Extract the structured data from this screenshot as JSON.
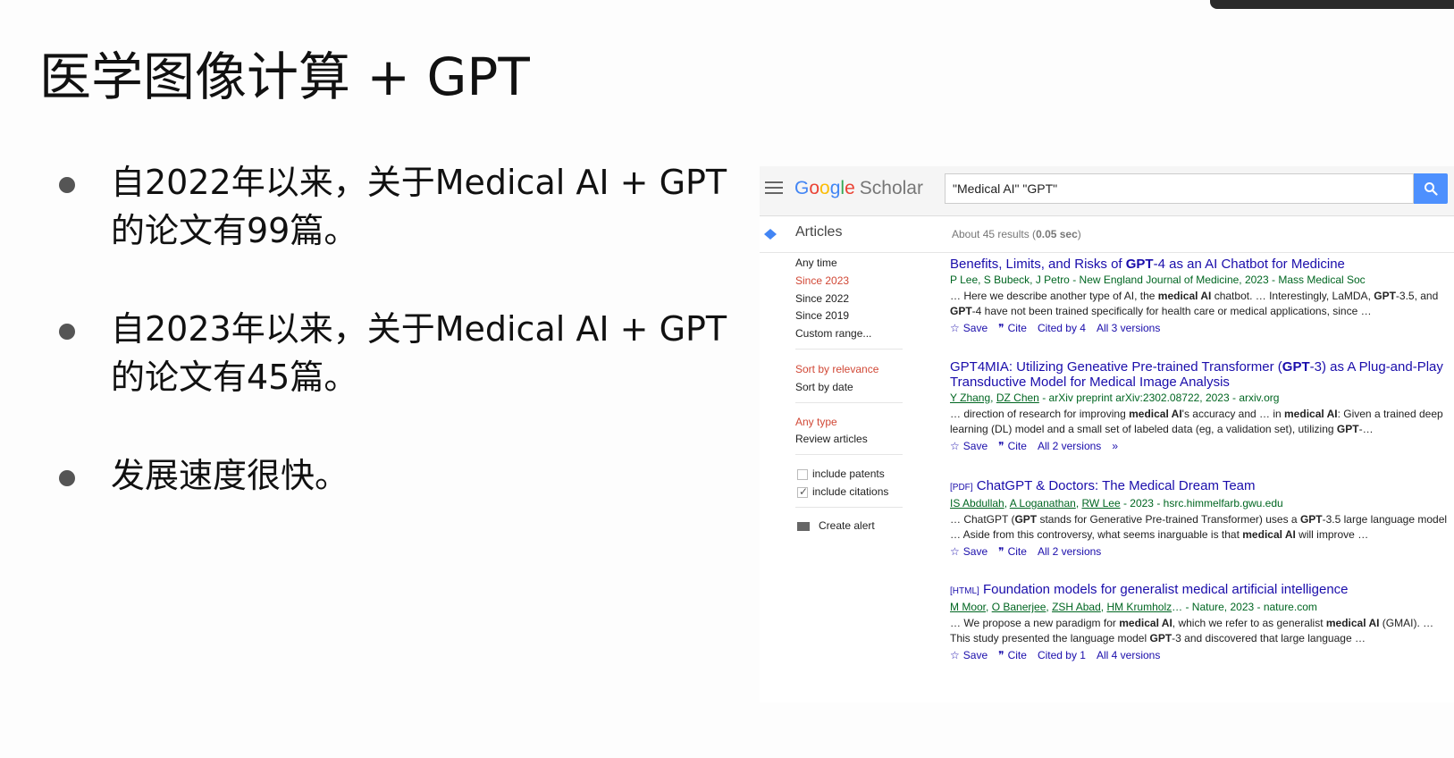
{
  "slide": {
    "title": "医学图像计算 + GPT",
    "bullets": [
      {
        "line1": "自2022年以来，关于Medical AI + GPT",
        "line2": "的论文有99篇。"
      },
      {
        "line1": "自2023年以来，关于Medical AI + GPT",
        "line2": "的论文有45篇。"
      },
      {
        "line1": "发展速度很快。",
        "line2": ""
      }
    ]
  },
  "scholar": {
    "logo": {
      "google": [
        "G",
        "o",
        "o",
        "g",
        "l",
        "e"
      ],
      "scholar": "Scholar"
    },
    "search_query": "\"Medical AI\" \"GPT\"",
    "articles_label": "Articles",
    "results_prefix": "About 45 results (",
    "results_time": "0.05 sec",
    "results_suffix": ")",
    "sidebar": {
      "time_filters": [
        "Any time",
        "Since 2023",
        "Since 2022",
        "Since 2019",
        "Custom range..."
      ],
      "sort": [
        "Sort by relevance",
        "Sort by date"
      ],
      "type": [
        "Any type",
        "Review articles"
      ],
      "include_patents": "include patents",
      "include_citations": "include citations",
      "create_alert": "Create alert"
    },
    "results": [
      {
        "tag": "",
        "title_html": "Benefits, Limits, and Risks of <b>GPT</b>-4 as an AI Chatbot for Medicine",
        "authors_html": "P Lee, S Bubeck, J Petro - New England Journal of Medicine, 2023 - Mass Medical Soc",
        "snippet_html": "… Here we describe another type of AI, the <b>medical AI</b> chatbot. … Interestingly, LaMDA, <b>GPT</b>-3.5, and <b>GPT</b>-4 have not been trained specifically for health care or medical applications, since …",
        "actions": [
          "Save",
          "Cite",
          "Cited by 4",
          "All 3 versions"
        ]
      },
      {
        "tag": "",
        "title_html": "GPT4MIA: Utilizing Geneative Pre-trained Transformer (<b>GPT</b>-3) as A Plug-and-Play Transductive Model for Medical Image Analysis",
        "authors_html": "<span class=\"ul\">Y Zhang</span>, <span class=\"ul\">DZ Chen</span> - arXiv preprint arXiv:2302.08722, 2023 - arxiv.org",
        "snippet_html": "… direction of research for improving <b>medical AI</b>'s accuracy and … in <b>medical AI</b>: Given a trained deep learning (DL) model and a small set of labeled data (eg, a validation set), utilizing <b>GPT</b>-…",
        "actions": [
          "Save",
          "Cite",
          "All 2 versions",
          "»"
        ]
      },
      {
        "tag": "[PDF]",
        "title_html": "ChatGPT &amp; Doctors: The Medical Dream Team",
        "authors_html": "<span class=\"ul\">IS Abdullah</span>, <span class=\"ul\">A Loganathan</span>, <span class=\"ul\">RW Lee</span> - 2023 - hsrc.himmelfarb.gwu.edu",
        "snippet_html": "… ChatGPT (<b>GPT</b> stands for Generative Pre-trained Transformer) uses a <b>GPT</b>-3.5 large language model … Aside from this controversy, what seems inarguable is that <b>medical AI</b> will improve …",
        "actions": [
          "Save",
          "Cite",
          "All 2 versions"
        ]
      },
      {
        "tag": "[HTML]",
        "title_html": "Foundation models for generalist medical artificial intelligence",
        "authors_html": "<span class=\"ul\">M Moor</span>, <span class=\"ul\">O Banerjee</span>, <span class=\"ul\">ZSH Abad</span>, <span class=\"ul\">HM Krumholz</span>… - Nature, 2023 - nature.com",
        "snippet_html": "… We propose a new paradigm for <b>medical AI</b>, which we refer to as generalist <b>medical AI</b> (GMAI). … This study presented the language model <b>GPT</b>-3 and discovered that large language …",
        "actions": [
          "Save",
          "Cite",
          "Cited by 1",
          "All 4 versions"
        ]
      }
    ]
  }
}
